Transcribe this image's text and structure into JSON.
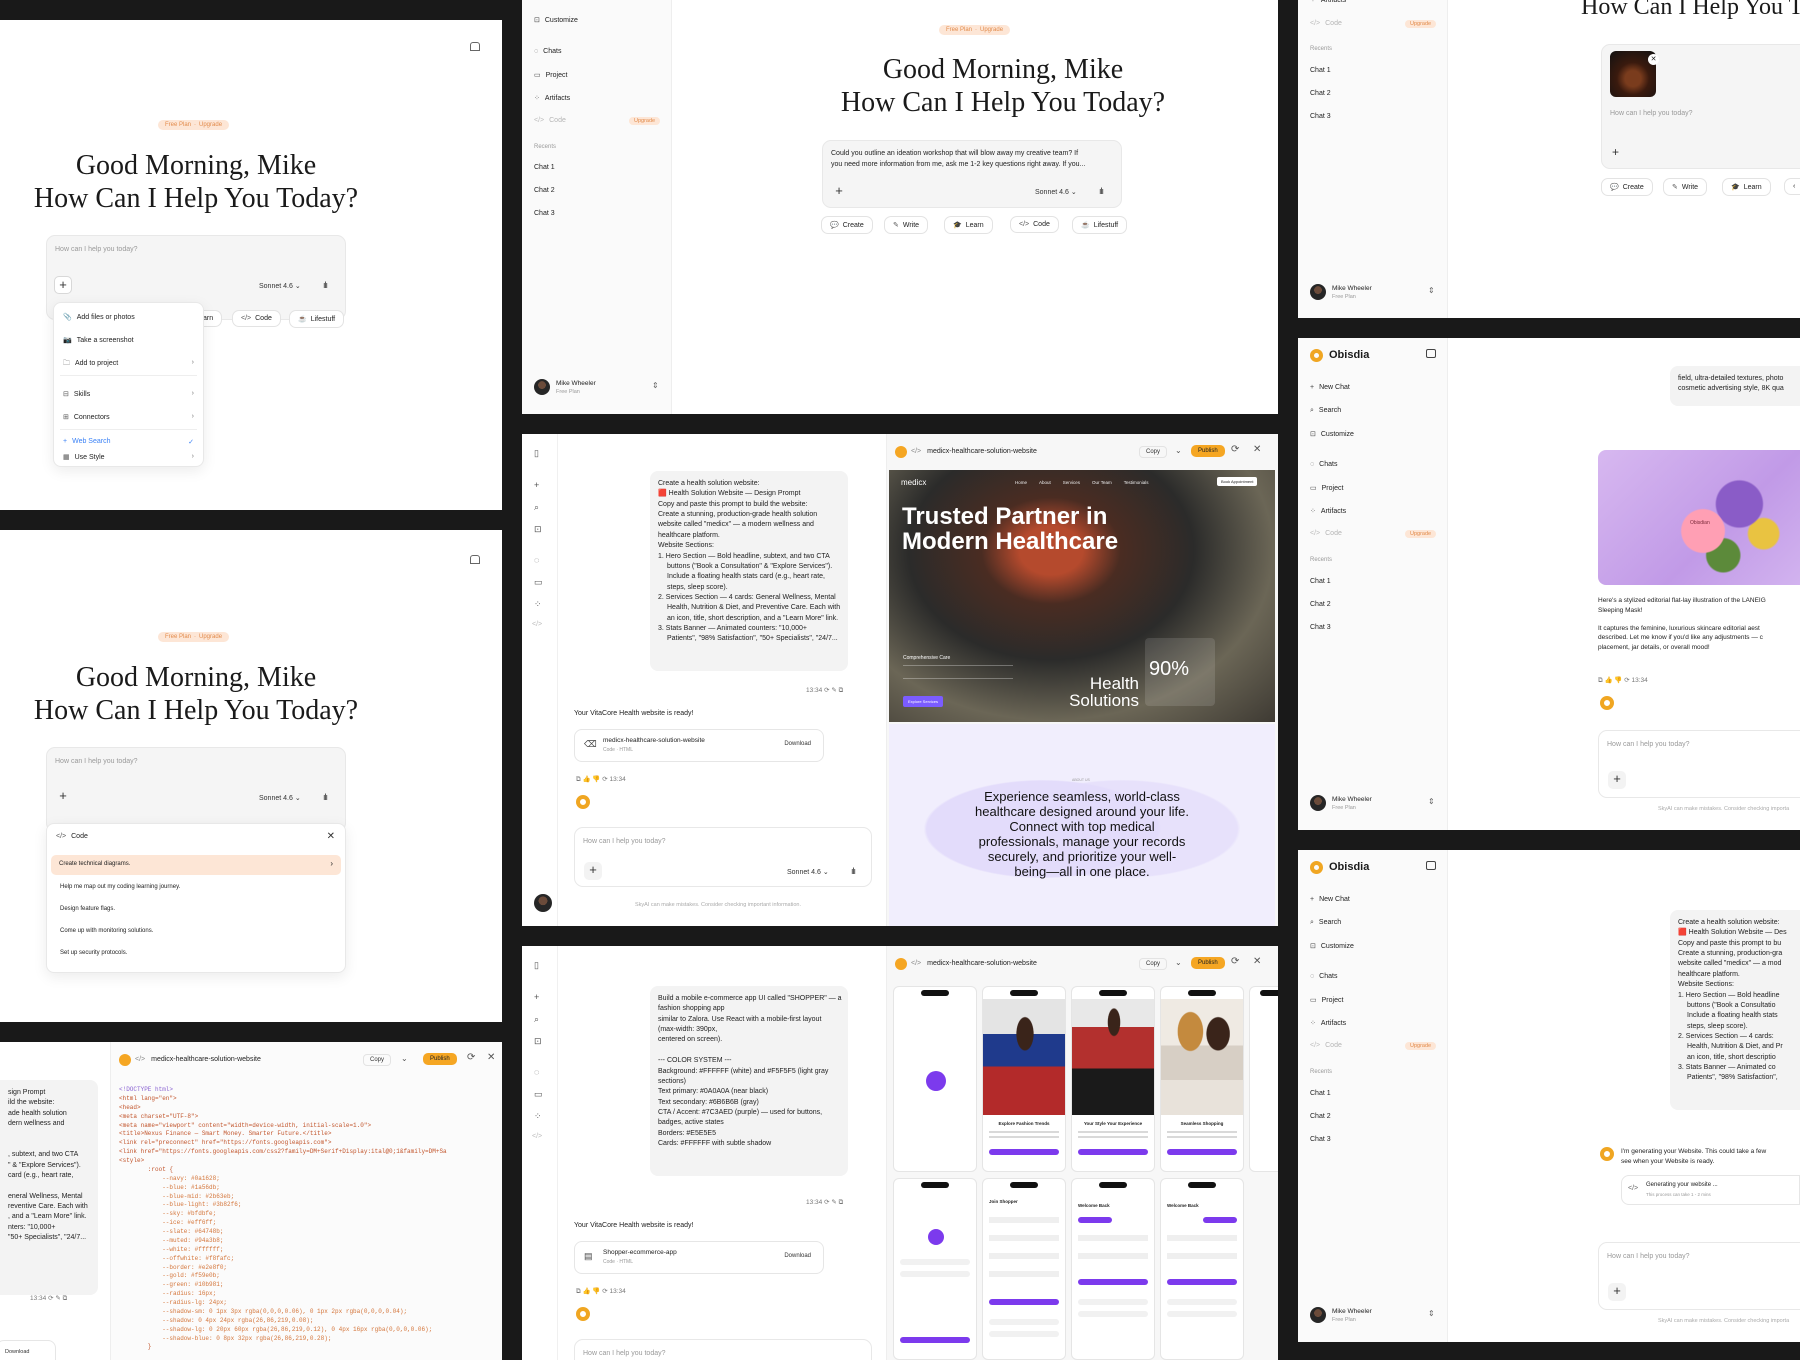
{
  "greeting": {
    "line1": "Good Morning, Mike",
    "line2": "How Can I Help You Today?"
  },
  "plan_pill": {
    "plan": "Free Plan",
    "sep": "·",
    "action": "Upgrade"
  },
  "composer": {
    "placeholder": "How can I help you today?",
    "model": "Sonnet 4.6",
    "model_caret": "⌄"
  },
  "prompt_sample": {
    "line1": "Could you outline an ideation workshop that will blow away my creative team? If",
    "line2": "you need more information from me, ask me 1-2 key questions right away. If you..."
  },
  "chips": [
    {
      "icon": "💬",
      "label": "Create"
    },
    {
      "icon": "✎",
      "label": "Write"
    },
    {
      "icon": "🎓",
      "label": "Learn"
    },
    {
      "icon": "</>",
      "label": "Code"
    },
    {
      "icon": "☕",
      "label": "Lifestuff"
    }
  ],
  "chips_partial": {
    "learn_cut": "arn",
    "code": "Code",
    "lifestuff": "Lifestuff"
  },
  "attach_menu": [
    {
      "icon": "📎",
      "label": "Add files or photos",
      "arrow": ""
    },
    {
      "icon": "📷",
      "label": "Take a screenshot",
      "arrow": ""
    },
    {
      "icon": "🗀",
      "label": "Add to project",
      "arrow": "›"
    },
    {
      "icon": "⊟",
      "label": "Skills",
      "arrow": "›"
    },
    {
      "icon": "⊞",
      "label": "Connectors",
      "arrow": "›"
    },
    {
      "icon": "+",
      "label": "Web Search",
      "arrow": "✓"
    },
    {
      "icon": "▦",
      "label": "Use Style",
      "arrow": "›"
    }
  ],
  "code_menu": {
    "title": "Code",
    "icon": "</>",
    "close": "✕",
    "items": [
      "Create technical diagrams.",
      "Help me map out my coding learning journey.",
      "Design feature flags.",
      "Come up with monitoring solutions.",
      "Set up security protocols."
    ]
  },
  "sidebar": {
    "brand": "Obisdia",
    "search": "Search",
    "customize": "Customize",
    "new_chat": "New Chat",
    "chats": "Chats",
    "project": "Project",
    "artifacts": "Artifacts",
    "code": "Code",
    "upgrade": "Upgrade",
    "recents": "Recents",
    "recent_items": [
      "Chat 1",
      "Chat 2",
      "Chat 3"
    ]
  },
  "user": {
    "name": "Mike Wheeler",
    "plan": "Free Plan",
    "swap": "⇕"
  },
  "health_prompt": [
    "Create a health solution website:",
    "🟥 Health Solution Website — Design Prompt",
    "Copy and paste this prompt to build the website:",
    "Create a stunning, production-grade health solution",
    "website called \"medicx\" — a modern wellness and",
    "healthcare platform.",
    "Website Sections:",
    "1. Hero Section — Bold headline, subtext, and two CTA",
    "buttons (\"Book a Consultation\" & \"Explore Services\").",
    "Include a floating health stats card (e.g., heart rate,",
    "steps, sleep score).",
    "2. Services Section — 4 cards: General Wellness, Mental",
    "Health, Nutrition & Diet, and Preventive Care. Each with",
    "an icon, title, short description, and a \"Learn More\" link.",
    "3. Stats Banner — Animated counters: \"10,000+",
    "Patients\", \"98% Satisfaction\", \"50+ Specialists\", \"24/7..."
  ],
  "health_prompt_right": [
    "Create a health solution website:",
    "🟥 Health Solution Website — Des",
    "Copy and paste this prompt to bu",
    "Create a stunning, production-gra",
    "website called \"medicx\" — a mod",
    "healthcare platform.",
    "Website Sections:",
    "1. Hero Section — Bold headline",
    "buttons (\"Book a Consultatio",
    "Include a floating health stats",
    "steps, sleep score).",
    "2. Services Section — 4 cards:",
    "Health, Nutrition & Diet, and Pr",
    "an icon, title, short descriptio",
    "3. Stats Banner — Animated co",
    "Patients\", \"98% Satisfaction\","
  ],
  "health_prompt_left_cut": [
    "sign Prompt",
    "ild the website:",
    "ade health solution",
    "dern wellness and",
    "",
    "",
    ", subtext, and two CTA",
    "\" & \"Explore Services\").",
    "card (e.g., heart rate,",
    "",
    "eneral Wellness, Mental",
    "reventive Care. Each with",
    ", and a \"Learn More\" link.",
    "nters: \"10,000+",
    "\"50+ Specialists\", \"24/7..."
  ],
  "message_meta": {
    "time": "13:34",
    "icons": "⟳ ✎ ⧉"
  },
  "result": {
    "ready": "Your VitaCore Health website is ready!",
    "file_title": "medicx-healthcare-solution-website",
    "file_sub": "Code · HTML",
    "download": "Download",
    "file2_title": "Shopper-ecommerce-app",
    "actions": "⧉ 👍 👎 ⟳",
    "time": "13:34"
  },
  "disclaimer": "SkyAI can make mistakes. Consider checking important information.",
  "disclaimer_cut": "SkyAI can make mistakes. Consider checking importa",
  "preview": {
    "file": "medicx-healthcare-solution-website",
    "copy": "Copy",
    "publish": "Publish",
    "site_brand": "medicx",
    "nav": [
      "Home",
      "About",
      "Services",
      "Our Team",
      "Testimonials"
    ],
    "book": "Book Appointment",
    "hero1": "Trusted Partner in",
    "hero2": "Modern Healthcare",
    "comp_care": "Comprehensive Care",
    "explore": "Explore Services",
    "health_sol1": "Health",
    "health_sol2": "Solutions",
    "stat": "90%",
    "about_tag": "ABOUT US",
    "about_text": [
      "Experience seamless, world-class",
      "healthcare designed around your life.",
      "Connect with top medical",
      "professionals, manage your records",
      "securely, and prioritize your well-",
      "being—all in one place."
    ]
  },
  "shopper_prompt": [
    "Build a mobile e-commerce app UI called \"SHOPPER\" — a",
    "fashion shopping app",
    "similar to Zalora. Use React with a mobile-first layout",
    "(max-width: 390px,",
    "centered on screen).",
    "",
    "--- COLOR SYSTEM ---",
    "Background: #FFFFFF (white) and #F5F5F5 (light gray",
    "sections)",
    "Text primary: #0A0A0A (near black)",
    "Text secondary: #6B6B6B (gray)",
    "CTA / Accent: #7C3AED (purple) — used for buttons,",
    "badges, active states",
    "Borders: #E5E5E5",
    "Cards: #FFFFFF with subtle shadow"
  ],
  "shopper_screens": [
    "Explore Fashion Trends",
    "Your Style Your Experience",
    "Seamless Shopping",
    "Join Shopper",
    "Welcome Back",
    "Welcome Back"
  ],
  "cosmetic": {
    "cut_top": [
      "field, ultra-detailed textures, photo",
      "cosmetic advertising style, 8K qua"
    ],
    "caption": [
      "Here's a stylized editorial flat-lay illustration of the LANEIG",
      "Sleeping Mask!"
    ],
    "desc": [
      "It captures the feminine, luxurious skincare editorial aest",
      "described. Let me know if you'd like any adjustments — c",
      "placement, jar details, or overall mood!"
    ],
    "jar_label": "Obisdian"
  },
  "generating": {
    "msg1": "I'm generating your Website. This could take a few",
    "msg2": "see when your Website is ready.",
    "card_title": "Generating your website ...",
    "card_sub": "This process can take 1 - 2 mins"
  },
  "code_lines": [
    {
      "t": "<!DOCTYPE html>",
      "c": "#8a63d2"
    },
    {
      "t": "<html lang=\"en\">",
      "c": "#c2552c"
    },
    {
      "t": "<head>",
      "c": "#c2552c"
    },
    {
      "t": "<meta charset=\"UTF-8\">",
      "c": "#c2552c"
    },
    {
      "t": "<meta name=\"viewport\" content=\"width=device-width, initial-scale=1.0\">",
      "c": "#c2552c"
    },
    {
      "t": "<title>Nexus Finance — Smart Money. Smarter Future.</title>",
      "c": "#c2552c"
    },
    {
      "t": "<link rel=\"preconnect\" href=\"https://fonts.googleapis.com\">",
      "c": "#c2552c"
    },
    {
      "t": "<link href=\"https://fonts.googleapis.com/css2?family=DM+Serif+Display:ital@0;1&family=DM+Sa",
      "c": "#c2552c"
    },
    {
      "t": "<style>",
      "c": "#c2552c"
    },
    {
      "t": "        :root {",
      "c": "#c2552c"
    },
    {
      "t": "            --navy: #0a1628;",
      "c": "#d4753a"
    },
    {
      "t": "            --blue: #1a56db;",
      "c": "#d4753a"
    },
    {
      "t": "            --blue-mid: #2b63eb;",
      "c": "#d4753a"
    },
    {
      "t": "            --blue-light: #3b82f6;",
      "c": "#d4753a"
    },
    {
      "t": "            --sky: #bfdbfe;",
      "c": "#d4753a"
    },
    {
      "t": "            --ice: #eff6ff;",
      "c": "#d4753a"
    },
    {
      "t": "            --slate: #64748b;",
      "c": "#d4753a"
    },
    {
      "t": "            --muted: #94a3b8;",
      "c": "#d4753a"
    },
    {
      "t": "            --white: #ffffff;",
      "c": "#d4753a"
    },
    {
      "t": "            --offwhite: #f8fafc;",
      "c": "#d4753a"
    },
    {
      "t": "            --border: #e2e8f0;",
      "c": "#d4753a"
    },
    {
      "t": "            --gold: #f59e0b;",
      "c": "#d4753a"
    },
    {
      "t": "            --green: #10b981;",
      "c": "#d4753a"
    },
    {
      "t": "            --radius: 16px;",
      "c": "#d4753a"
    },
    {
      "t": "            --radius-lg: 24px;",
      "c": "#d4753a"
    },
    {
      "t": "            --shadow-sm: 0 1px 3px rgba(0,0,0,0.06), 0 1px 2px rgba(0,0,0,0.04);",
      "c": "#d4753a"
    },
    {
      "t": "            --shadow: 0 4px 24px rgba(26,86,219,0.08);",
      "c": "#d4753a"
    },
    {
      "t": "            --shadow-lg: 0 20px 60px rgba(26,86,219,0.12), 0 4px 16px rgba(0,0,0,0.06);",
      "c": "#d4753a"
    },
    {
      "t": "            --shadow-blue: 0 8px 32px rgba(26,86,219,0.28);",
      "c": "#d4753a"
    },
    {
      "t": "        }",
      "c": "#c2552c"
    },
    {
      "t": "",
      "c": "#c2552c"
    },
    {
      "t": "*, *::before, *::after { box-sizing: border-box; margin: 0; padding: 0; }",
      "c": "#c2552c"
    },
    {
      "t": "",
      "c": "#c2552c"
    },
    {
      "t": "  html { scroll-behavior: smooth; }",
      "c": "#c2552c"
    }
  ],
  "code_meta": {
    "time": "13:34",
    "download": "Download"
  },
  "colors": {
    "accent": "#f5a623",
    "pill_bg": "#fde6d6",
    "pill_text": "#e28b4b",
    "purple": "#7c3aed",
    "bg": "#191919"
  }
}
